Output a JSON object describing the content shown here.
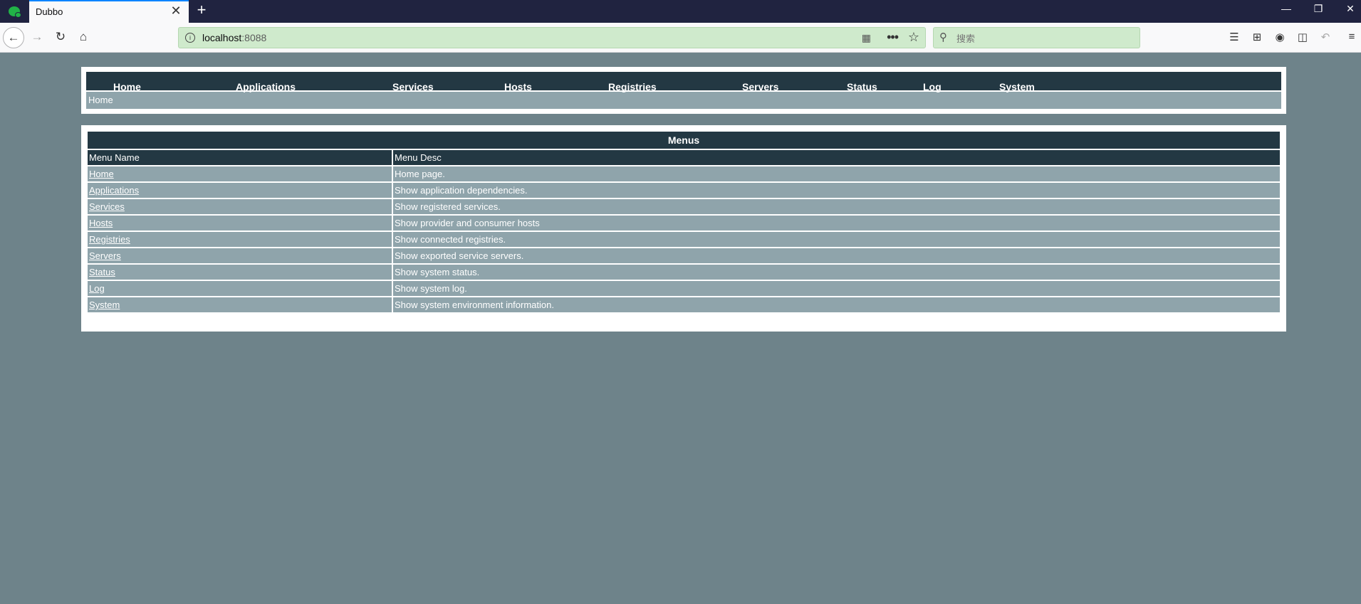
{
  "browser": {
    "tab_title": "Dubbo",
    "tab_close": "✕",
    "new_tab": "+",
    "url_host": "localhost",
    "url_port": ":8088",
    "search_placeholder": "搜索"
  },
  "nav": {
    "items": [
      {
        "label": "Home"
      },
      {
        "label": "Applications"
      },
      {
        "label": "Services"
      },
      {
        "label": "Hosts"
      },
      {
        "label": "Registries"
      },
      {
        "label": "Servers"
      },
      {
        "label": "Status"
      },
      {
        "label": "Log"
      },
      {
        "label": "System"
      }
    ]
  },
  "breadcrumb": "Home",
  "menus": {
    "caption": "Menus",
    "col_name": "Menu Name",
    "col_desc": "Menu Desc",
    "rows": [
      {
        "name": "Home",
        "desc": "Home page."
      },
      {
        "name": "Applications",
        "desc": "Show application dependencies."
      },
      {
        "name": "Services",
        "desc": "Show registered services."
      },
      {
        "name": "Hosts",
        "desc": "Show provider and consumer hosts"
      },
      {
        "name": "Registries",
        "desc": "Show connected registries."
      },
      {
        "name": "Servers",
        "desc": "Show exported service servers."
      },
      {
        "name": "Status",
        "desc": "Show system status."
      },
      {
        "name": "Log",
        "desc": "Show system log."
      },
      {
        "name": "System",
        "desc": "Show system environment information."
      }
    ]
  }
}
